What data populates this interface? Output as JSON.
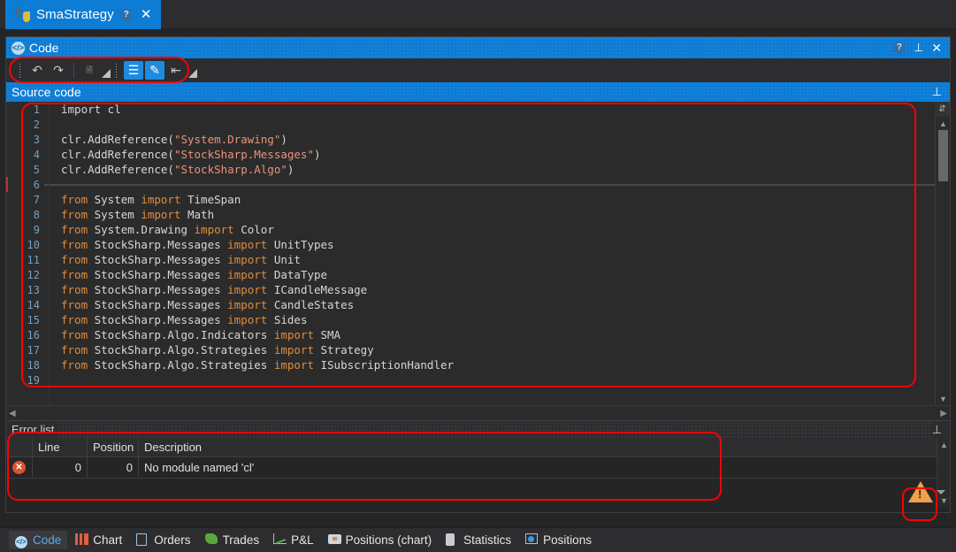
{
  "strategy_tab": {
    "title": "SmaStrategy",
    "icon": "python-icon",
    "help_label": "?",
    "close_label": "✕"
  },
  "code_panel": {
    "caption": "Code",
    "icon": "code-badge-icon",
    "help_label": "?",
    "pin_label": "📌",
    "close_label": "✕",
    "toolbar": {
      "buttons": [
        {
          "name": "undo-button",
          "glyph": "↶",
          "active": false
        },
        {
          "name": "redo-button",
          "glyph": "↷",
          "active": false
        },
        {
          "name": "references-button",
          "glyph": "DLL",
          "active": false
        },
        {
          "name": "references-dropdown",
          "glyph": "◢",
          "active": false
        },
        {
          "name": "code-list-button",
          "glyph": "☰",
          "active": true
        },
        {
          "name": "highlighter-button",
          "glyph": "✎",
          "active": true
        },
        {
          "name": "indent-button",
          "glyph": "⇥",
          "active": false
        },
        {
          "name": "indent-dropdown",
          "glyph": "◢",
          "active": false
        }
      ]
    },
    "source_caption": "Source code",
    "source_pin_label": "📌"
  },
  "editor": {
    "lines": [
      {
        "no": "1",
        "tokens": [
          {
            "t": "import cl",
            "c": "plain"
          }
        ]
      },
      {
        "no": "2",
        "tokens": []
      },
      {
        "no": "3",
        "tokens": [
          {
            "t": "clr.AddReference(",
            "c": "plain"
          },
          {
            "t": "\"System.Drawing\"",
            "c": "str"
          },
          {
            "t": ")",
            "c": "plain"
          }
        ]
      },
      {
        "no": "4",
        "tokens": [
          {
            "t": "clr.AddReference(",
            "c": "plain"
          },
          {
            "t": "\"StockSharp.Messages\"",
            "c": "str"
          },
          {
            "t": ")",
            "c": "plain"
          }
        ]
      },
      {
        "no": "5",
        "tokens": [
          {
            "t": "clr.AddReference(",
            "c": "plain"
          },
          {
            "t": "\"StockSharp.Algo\"",
            "c": "str"
          },
          {
            "t": ")",
            "c": "plain"
          }
        ]
      },
      {
        "no": "6",
        "tokens": [],
        "current": true
      },
      {
        "no": "7",
        "tokens": [
          {
            "t": "from",
            "c": "kw"
          },
          {
            "t": " System ",
            "c": "plain"
          },
          {
            "t": "import",
            "c": "kw"
          },
          {
            "t": " TimeSpan",
            "c": "plain"
          }
        ]
      },
      {
        "no": "8",
        "tokens": [
          {
            "t": "from",
            "c": "kw"
          },
          {
            "t": " System ",
            "c": "plain"
          },
          {
            "t": "import",
            "c": "kw"
          },
          {
            "t": " Math",
            "c": "plain"
          }
        ]
      },
      {
        "no": "9",
        "tokens": [
          {
            "t": "from",
            "c": "kw"
          },
          {
            "t": " System.Drawing ",
            "c": "plain"
          },
          {
            "t": "import",
            "c": "kw"
          },
          {
            "t": " Color",
            "c": "plain"
          }
        ]
      },
      {
        "no": "10",
        "tokens": [
          {
            "t": "from",
            "c": "kw"
          },
          {
            "t": " StockSharp.Messages ",
            "c": "plain"
          },
          {
            "t": "import",
            "c": "kw"
          },
          {
            "t": " UnitTypes",
            "c": "plain"
          }
        ]
      },
      {
        "no": "11",
        "tokens": [
          {
            "t": "from",
            "c": "kw"
          },
          {
            "t": " StockSharp.Messages ",
            "c": "plain"
          },
          {
            "t": "import",
            "c": "kw"
          },
          {
            "t": " Unit",
            "c": "plain"
          }
        ]
      },
      {
        "no": "12",
        "tokens": [
          {
            "t": "from",
            "c": "kw"
          },
          {
            "t": " StockSharp.Messages ",
            "c": "plain"
          },
          {
            "t": "import",
            "c": "kw"
          },
          {
            "t": " DataType",
            "c": "plain"
          }
        ]
      },
      {
        "no": "13",
        "tokens": [
          {
            "t": "from",
            "c": "kw"
          },
          {
            "t": " StockSharp.Messages ",
            "c": "plain"
          },
          {
            "t": "import",
            "c": "kw"
          },
          {
            "t": " ICandleMessage",
            "c": "plain"
          }
        ]
      },
      {
        "no": "14",
        "tokens": [
          {
            "t": "from",
            "c": "kw"
          },
          {
            "t": " StockSharp.Messages ",
            "c": "plain"
          },
          {
            "t": "import",
            "c": "kw"
          },
          {
            "t": " CandleStates",
            "c": "plain"
          }
        ]
      },
      {
        "no": "15",
        "tokens": [
          {
            "t": "from",
            "c": "kw"
          },
          {
            "t": " StockSharp.Messages ",
            "c": "plain"
          },
          {
            "t": "import",
            "c": "kw"
          },
          {
            "t": " Sides",
            "c": "plain"
          }
        ]
      },
      {
        "no": "16",
        "tokens": [
          {
            "t": "from",
            "c": "kw"
          },
          {
            "t": " StockSharp.Algo.Indicators ",
            "c": "plain"
          },
          {
            "t": "import",
            "c": "kw"
          },
          {
            "t": " SMA",
            "c": "plain"
          }
        ]
      },
      {
        "no": "17",
        "tokens": [
          {
            "t": "from",
            "c": "kw"
          },
          {
            "t": " StockSharp.Algo.Strategies ",
            "c": "plain"
          },
          {
            "t": "import",
            "c": "kw"
          },
          {
            "t": " Strategy",
            "c": "plain"
          }
        ]
      },
      {
        "no": "18",
        "tokens": [
          {
            "t": "from",
            "c": "kw"
          },
          {
            "t": " StockSharp.Algo.Strategies ",
            "c": "plain"
          },
          {
            "t": "import",
            "c": "kw"
          },
          {
            "t": " ISubscriptionHandler",
            "c": "plain"
          }
        ]
      },
      {
        "no": "19",
        "tokens": []
      }
    ]
  },
  "error_list": {
    "caption": "Error list",
    "pin_label": "📌",
    "columns": [
      "",
      "Line",
      "Position",
      "Description"
    ],
    "rows": [
      {
        "icon": "error-icon",
        "line": "0",
        "position": "0",
        "description": "No module named 'cl'"
      }
    ],
    "warning_icon": "warning-triangle-icon",
    "warning_caret": "▼"
  },
  "bottom_tabs": [
    {
      "label": "Code",
      "icon": "code-icon",
      "active": true
    },
    {
      "label": "Chart",
      "icon": "candles-icon",
      "active": false
    },
    {
      "label": "Orders",
      "icon": "orders-icon",
      "active": false
    },
    {
      "label": "Trades",
      "icon": "trades-icon",
      "active": false
    },
    {
      "label": "P&L",
      "icon": "pnl-icon",
      "active": false
    },
    {
      "label": "Positions (chart)",
      "icon": "briefcase-icon",
      "active": false
    },
    {
      "label": "Statistics",
      "icon": "clipboard-icon",
      "active": false
    },
    {
      "label": "Positions",
      "icon": "piechart-icon",
      "active": false
    }
  ],
  "colors": {
    "accent_blue": "#0c7cd5",
    "annotation_red": "#ff0000",
    "keyword_orange": "#e08c3e",
    "string_salmon": "#e8937a",
    "error_red": "#d9552e",
    "warning_orange": "#f0a04b",
    "window_bg": "#252526",
    "editor_bg": "#2b2b2b"
  }
}
